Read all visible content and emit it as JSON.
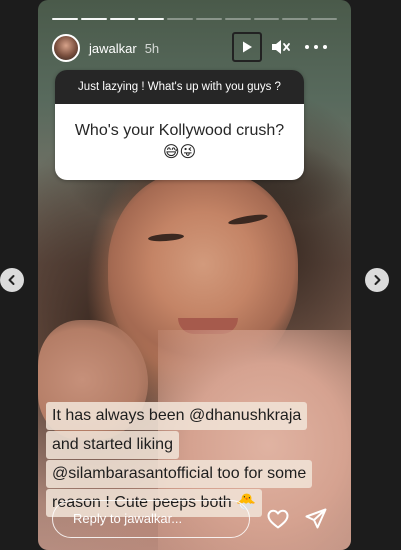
{
  "story": {
    "progress": {
      "segments": 10,
      "completed": 4
    },
    "header": {
      "username": "jawalkar",
      "time": "5h",
      "icons": {
        "play": "play-icon",
        "mute": "mute-icon",
        "more": "more-horizontal-icon"
      }
    },
    "question_sticker": {
      "prompt": "Just lazying ! What's up with you guys ?",
      "question": "Who's your Kollywood crush? 😅😜"
    },
    "caption": {
      "lines": [
        "It has always been @dhanushkraja",
        "and started liking",
        "@silambarasantofficial too for some",
        "reason ! Cute peeps both 🐣"
      ]
    },
    "reply": {
      "placeholder": "Reply to jawalkar...",
      "icons": {
        "like": "heart-icon",
        "share": "send-icon"
      }
    }
  },
  "navigation": {
    "prev_icon": "chevron-left-icon",
    "next_icon": "chevron-right-icon"
  }
}
